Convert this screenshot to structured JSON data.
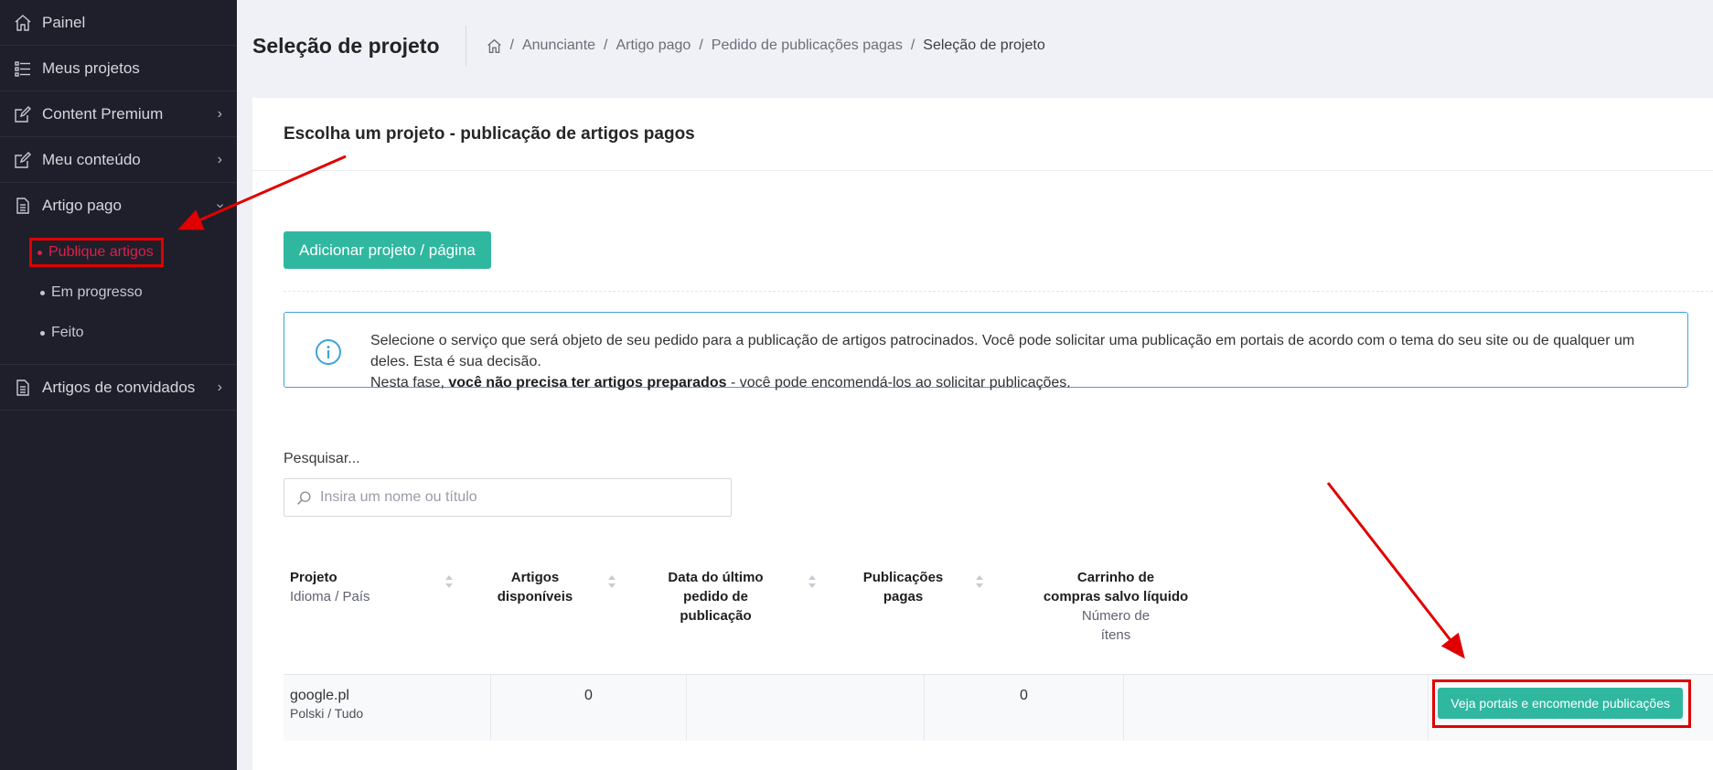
{
  "sidebar": {
    "items": [
      {
        "label": "Painel",
        "icon": "home-icon"
      },
      {
        "label": "Meus projetos",
        "icon": "list-icon"
      },
      {
        "label": "Content Premium",
        "icon": "edit-icon"
      },
      {
        "label": "Meu conteúdo",
        "icon": "edit-icon"
      },
      {
        "label": "Artigo pago",
        "icon": "document-icon"
      },
      {
        "label": "Artigos de convidados",
        "icon": "document-icon"
      }
    ],
    "submenu": [
      {
        "label": "Publique artigos",
        "active": true
      },
      {
        "label": "Em progresso"
      },
      {
        "label": "Feito"
      }
    ]
  },
  "header": {
    "title": "Seleção de projeto",
    "breadcrumb": [
      "Anunciante",
      "Artigo pago",
      "Pedido de publicações pagas",
      "Seleção de projeto"
    ]
  },
  "card": {
    "title": "Escolha um projeto - publicação de artigos pagos",
    "add_button": "Adicionar projeto / página",
    "info": {
      "line1": "Selecione o serviço que será objeto de seu pedido para a publicação de artigos patrocinados. Você pode solicitar uma publicação em portais de acordo com o tema do seu site ou de qualquer um deles. Esta é sua decisão.",
      "line2_prefix": "Nesta fase, ",
      "line2_bold": "você não precisa ter artigos preparados",
      "line2_suffix": " - você pode encomendá-los ao solicitar publicações."
    },
    "search": {
      "label": "Pesquisar...",
      "placeholder": "Insira um nome ou título"
    },
    "table": {
      "headers": {
        "project": "Projeto",
        "project_sub": "Idioma / País",
        "articles_1": "Artigos",
        "articles_2": "disponíveis",
        "date_1": "Data do último",
        "date_2": "pedido de",
        "date_3": "publicação",
        "paid_1": "Publicações",
        "paid_2": "pagas",
        "cart_1": "Carrinho de",
        "cart_2": "compras salvo líquido",
        "cart_sub_1": "Número de",
        "cart_sub_2": "ítens"
      },
      "rows": [
        {
          "project": "google.pl",
          "lang": "Polski / Tudo",
          "articles": "0",
          "date": "",
          "paid": "0",
          "cart": "",
          "action": "Veja portais e encomende publicações"
        }
      ]
    }
  },
  "colors": {
    "sidebar_bg": "#1e1f2b",
    "accent": "#30b7a0",
    "active": "#e11d48",
    "info_border": "#3ea3de",
    "annotation": "#e00000"
  }
}
